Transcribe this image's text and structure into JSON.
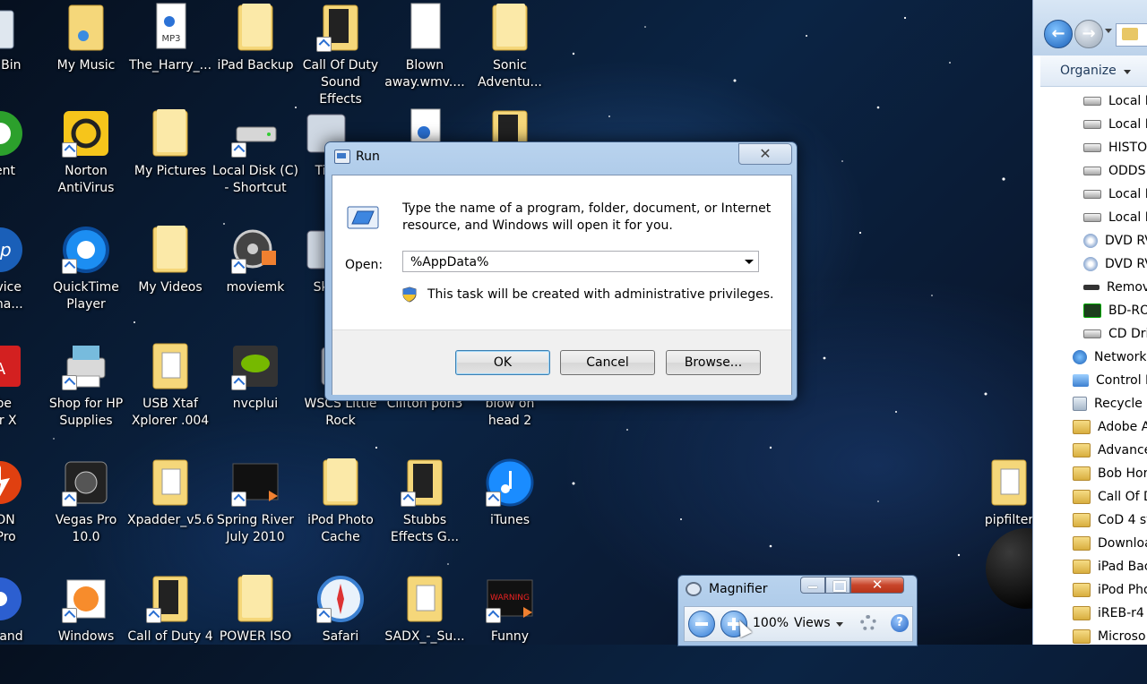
{
  "desktop": {
    "icons": [
      {
        "label": "cle Bin",
        "kind": "bin"
      },
      {
        "label": "My Music",
        "kind": "folder-music"
      },
      {
        "label": "The_Harry_...",
        "kind": "mp3"
      },
      {
        "label": "iPad Backup",
        "kind": "folder"
      },
      {
        "label": "Call Of Duty\nSound Effects",
        "kind": "folder-dark"
      },
      {
        "label": "Blown\naway.wmv....",
        "kind": "file"
      },
      {
        "label": "Sonic\nAdventu...",
        "kind": "folder"
      },
      {
        "label": "rrent",
        "kind": "utorrent"
      },
      {
        "label": "Norton\nAntiVirus",
        "kind": "norton"
      },
      {
        "label": "My Pictures",
        "kind": "folder"
      },
      {
        "label": "Local Disk (C)\n- Shortcut",
        "kind": "drive"
      },
      {
        "label": "Tini",
        "kind": "app"
      },
      {
        "label": "",
        "kind": "music-file"
      },
      {
        "label": "",
        "kind": "folder-dark"
      },
      {
        "label": "Device\nosma...",
        "kind": "hp"
      },
      {
        "label": "QuickTime\nPlayer",
        "kind": "quicktime"
      },
      {
        "label": "My Videos",
        "kind": "folder"
      },
      {
        "label": "moviemk",
        "kind": "moviemaker"
      },
      {
        "label": "Skill",
        "kind": "app"
      },
      {
        "label": "obe\nder X",
        "kind": "adobe"
      },
      {
        "label": "Shop for HP\nSupplies",
        "kind": "printer"
      },
      {
        "label": "USB Xtaf\nXplorer .004",
        "kind": "folder-file"
      },
      {
        "label": "nvcplui",
        "kind": "nvidia"
      },
      {
        "label": "WSCS Little\nRock",
        "kind": "app"
      },
      {
        "label": "Clifton pon3",
        "kind": "app"
      },
      {
        "label": "blow on\nhead 2",
        "kind": "app"
      },
      {
        "label": "MON\nn Pro",
        "kind": "daemon"
      },
      {
        "label": "Vegas Pro\n10.0",
        "kind": "vegas"
      },
      {
        "label": "Xpadder_v5.6",
        "kind": "folder-file"
      },
      {
        "label": "Spring River\nJuly 2010",
        "kind": "video"
      },
      {
        "label": "iPod Photo\nCache",
        "kind": "folder"
      },
      {
        "label": "Stubbs\nEffects G...",
        "kind": "folder-dark"
      },
      {
        "label": "iTunes",
        "kind": "itunes"
      },
      {
        "label": "CD and",
        "kind": "cd"
      },
      {
        "label": "Windows",
        "kind": "windows"
      },
      {
        "label": "Call of Duty 4",
        "kind": "folder-dark"
      },
      {
        "label": "POWER ISO",
        "kind": "folder"
      },
      {
        "label": "Safari",
        "kind": "safari"
      },
      {
        "label": "SADX_-_Su...",
        "kind": "folder-file"
      },
      {
        "label": "Funny",
        "kind": "video-warn"
      },
      {
        "label": "pipfilter",
        "kind": "folder-file"
      }
    ]
  },
  "run_dialog": {
    "title": "Run",
    "close_symbol": "✕",
    "description": "Type the name of a program, folder, document, or Internet resource, and Windows will open it for you.",
    "open_label": "Open:",
    "open_value": "%AppData%",
    "admin_note": "This task will be created with administrative privileges.",
    "ok_label": "OK",
    "cancel_label": "Cancel",
    "browse_label": "Browse..."
  },
  "explorer": {
    "back_symbol": "←",
    "forward_symbol": "→",
    "organize_label": "Organize",
    "tree": [
      {
        "label": "Local D",
        "icon": "drive"
      },
      {
        "label": "Local D",
        "icon": "drive"
      },
      {
        "label": "HISTO",
        "icon": "drive"
      },
      {
        "label": "ODDS a",
        "icon": "drive"
      },
      {
        "label": "Local D",
        "icon": "drive"
      },
      {
        "label": "Local D",
        "icon": "drive"
      },
      {
        "label": "DVD RV",
        "icon": "disc"
      },
      {
        "label": "DVD RV",
        "icon": "disc"
      },
      {
        "label": "Remov",
        "icon": "rem"
      },
      {
        "label": "BD-RO",
        "icon": "bd"
      },
      {
        "label": "CD Driv",
        "icon": "drive"
      },
      {
        "label": "Network",
        "icon": "net"
      },
      {
        "label": "Control I",
        "icon": "cp"
      },
      {
        "label": "Recycle I",
        "icon": "bin"
      },
      {
        "label": "Adobe A",
        "icon": "folder"
      },
      {
        "label": "Advance",
        "icon": "folder"
      },
      {
        "label": "Bob Hor",
        "icon": "folder"
      },
      {
        "label": "Call Of D",
        "icon": "folder"
      },
      {
        "label": "CoD 4 st",
        "icon": "folder"
      },
      {
        "label": "Downloa",
        "icon": "folder"
      },
      {
        "label": "iPad Bac",
        "icon": "folder"
      },
      {
        "label": "iPod Pho",
        "icon": "folder"
      },
      {
        "label": "iREB-r4",
        "icon": "folder"
      },
      {
        "label": "Microso",
        "icon": "folder"
      }
    ]
  },
  "magnifier": {
    "title": "Magnifier",
    "close_symbol": "✕",
    "zoom_level": "100%",
    "views_label": "Views",
    "help_symbol": "?"
  },
  "colors": {
    "folder": "#e9c65c",
    "accent": "#2f7ad6"
  }
}
